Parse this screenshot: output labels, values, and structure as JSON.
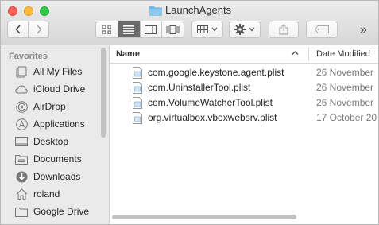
{
  "window": {
    "title": "LaunchAgents"
  },
  "toolbar": {
    "back_icon": "chevron-left-icon",
    "forward_icon": "chevron-right-icon",
    "view_modes": [
      "icon-view",
      "list-view",
      "column-view",
      "coverflow-view"
    ],
    "active_view": "list-view",
    "overflow_label": "»"
  },
  "sidebar": {
    "heading": "Favorites",
    "items": [
      {
        "label": "All My Files",
        "icon": "all-files-icon"
      },
      {
        "label": "iCloud Drive",
        "icon": "cloud-icon"
      },
      {
        "label": "AirDrop",
        "icon": "airdrop-icon"
      },
      {
        "label": "Applications",
        "icon": "applications-icon"
      },
      {
        "label": "Desktop",
        "icon": "desktop-icon"
      },
      {
        "label": "Documents",
        "icon": "documents-icon"
      },
      {
        "label": "Downloads",
        "icon": "downloads-icon"
      },
      {
        "label": "roland",
        "icon": "home-icon"
      },
      {
        "label": "Google Drive",
        "icon": "folder-icon"
      }
    ]
  },
  "list": {
    "columns": {
      "name": "Name",
      "date": "Date Modified"
    },
    "rows": [
      {
        "name": "com.google.keystone.agent.plist",
        "date": "26 November"
      },
      {
        "name": "com.UninstallerTool.plist",
        "date": "26 November"
      },
      {
        "name": "com.VolumeWatcherTool.plist",
        "date": "26 November"
      },
      {
        "name": "org.virtualbox.vboxwebsrv.plist",
        "date": "17 October 20"
      }
    ]
  }
}
